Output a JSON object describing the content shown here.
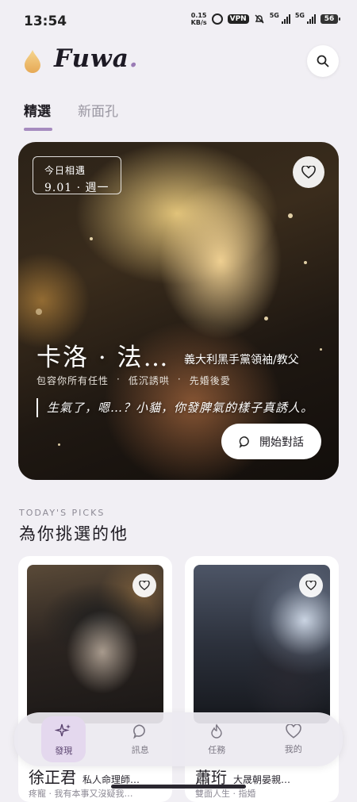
{
  "status_bar": {
    "time": "13:54",
    "speed": "0.15",
    "speed_unit": "KB/s",
    "vpn": "VPN",
    "sig1": "5G",
    "sig2": "5G",
    "battery": "56"
  },
  "header": {
    "logo_text": "Fuwa",
    "logo_dot": "."
  },
  "tabs": [
    {
      "label": "精選",
      "active": true
    },
    {
      "label": "新面孔",
      "active": false
    }
  ],
  "hero": {
    "date_label": "今日相遇",
    "date_value": "9.01 · 週一",
    "name": "卡洛 · 法…",
    "title": "義大利黑手黨領袖/教父",
    "tags": [
      "包容你所有任性",
      "·",
      "低沉誘哄",
      "·",
      "先婚後愛"
    ],
    "quote": "生氣了，嗯…？小貓，你發脾氣的樣子真誘人。",
    "cta_label": "開始對話"
  },
  "picks": {
    "eyebrow": "TODAY'S PICKS",
    "title": "為你挑選的他",
    "cards": [
      {
        "name": "徐正君",
        "subtitle": "私人命理師…",
        "tags": "疼寵  ·  我有本事又沒疑我…"
      },
      {
        "name": "蕭珩",
        "subtitle": "大晟朝晏親…",
        "tags": "雙面人生  ·  指婚"
      }
    ]
  },
  "bottom_nav": [
    {
      "label": "發現",
      "icon": "sparkle-icon",
      "active": true
    },
    {
      "label": "訊息",
      "icon": "chat-bubble-icon",
      "active": false
    },
    {
      "label": "任務",
      "icon": "flame-icon",
      "active": false
    },
    {
      "label": "我的",
      "icon": "heart-icon",
      "active": false
    }
  ],
  "colors": {
    "accent": "#a68bbf",
    "background": "#f1eff4",
    "nav_active_bg": "#e4d8ee"
  }
}
